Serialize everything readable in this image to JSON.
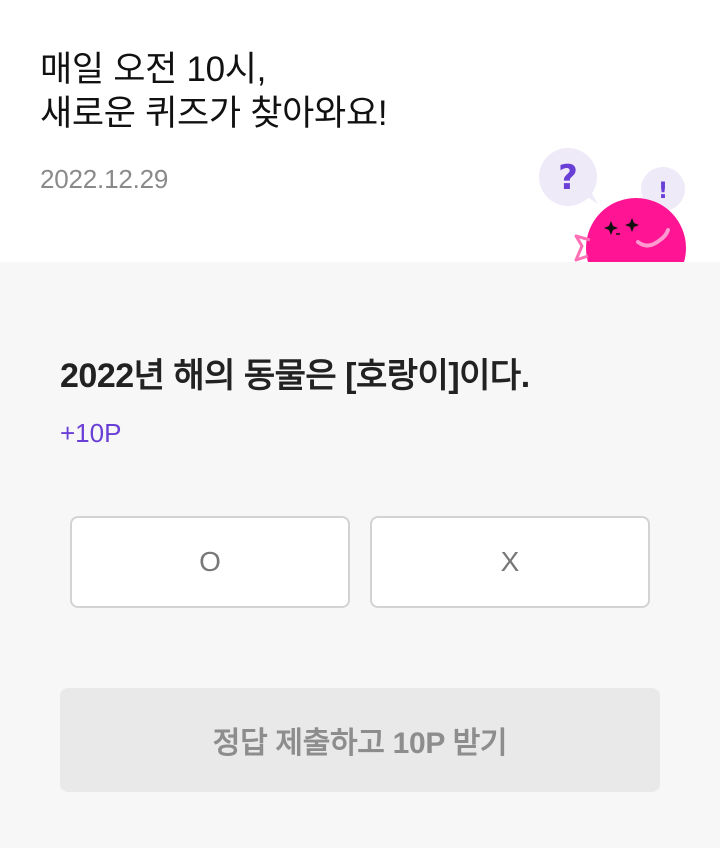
{
  "header": {
    "headline_line1": "매일 오전 10시,",
    "headline_line2": "새로운 퀴즈가 찾아와요!",
    "date": "2022.12.29"
  },
  "mascot": {
    "question_mark": "?",
    "exclamation_mark": "!",
    "body_color": "#ff1493",
    "bubble_color": "#efeaf8",
    "accent_color": "#6a3fd6"
  },
  "quiz": {
    "question": "2022년 해의 동물은 [호랑이]이다.",
    "points": "+10P",
    "options": [
      "O",
      "X"
    ],
    "submit_label": "정답 제출하고 10P 받기"
  },
  "colors": {
    "points_purple": "#6a3fd6",
    "background_gray": "#f7f7f7",
    "button_disabled": "#e9e9e9"
  }
}
